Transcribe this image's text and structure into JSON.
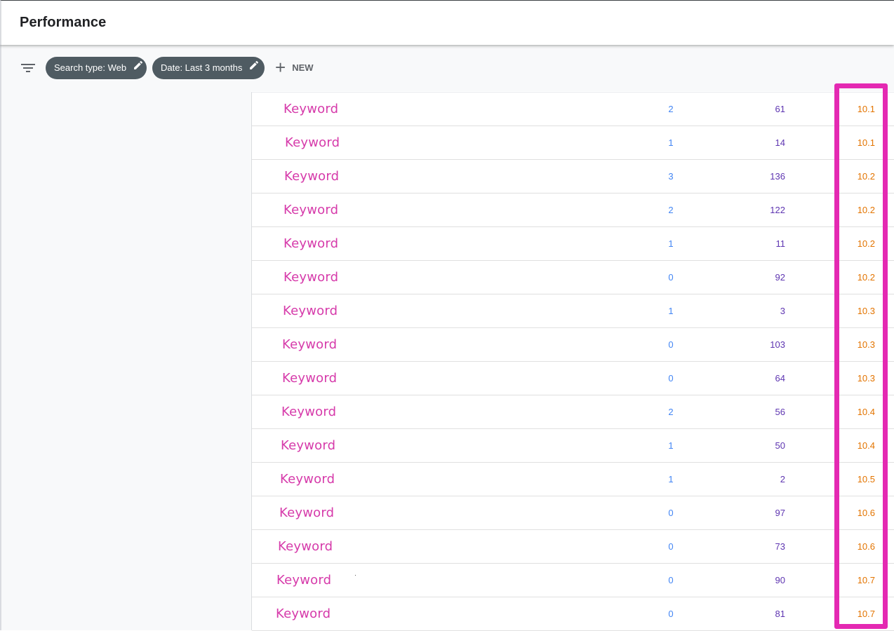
{
  "header": {
    "title": "Performance"
  },
  "filters": {
    "search_type_chip": "Search type: Web",
    "date_chip": "Date: Last 3 months",
    "new_label": "NEW"
  },
  "colors": {
    "keyword": "#d63aaa",
    "clicks": "#4285f4",
    "impressions": "#5e35b1",
    "position": "#e37400",
    "highlight_box": "#e429b2",
    "chip_bg": "#4f5b62"
  },
  "icons": {
    "filter": "filter-icon",
    "chip_edit": "pencil-icon",
    "new": "plus-icon"
  },
  "rows": [
    {
      "keyword": "Keyword",
      "clicks": "2",
      "impressions": "61",
      "position": "10.1"
    },
    {
      "keyword": "Keyword",
      "clicks": "1",
      "impressions": "14",
      "position": "10.1"
    },
    {
      "keyword": "Keyword",
      "clicks": "3",
      "impressions": "136",
      "position": "10.2"
    },
    {
      "keyword": "Keyword",
      "clicks": "2",
      "impressions": "122",
      "position": "10.2"
    },
    {
      "keyword": "Keyword",
      "clicks": "1",
      "impressions": "11",
      "position": "10.2"
    },
    {
      "keyword": "Keyword",
      "clicks": "0",
      "impressions": "92",
      "position": "10.2"
    },
    {
      "keyword": "Keyword",
      "clicks": "1",
      "impressions": "3",
      "position": "10.3"
    },
    {
      "keyword": "Keyword",
      "clicks": "0",
      "impressions": "103",
      "position": "10.3"
    },
    {
      "keyword": "Keyword",
      "clicks": "0",
      "impressions": "64",
      "position": "10.3"
    },
    {
      "keyword": "Keyword",
      "clicks": "2",
      "impressions": "56",
      "position": "10.4"
    },
    {
      "keyword": "Keyword",
      "clicks": "1",
      "impressions": "50",
      "position": "10.4"
    },
    {
      "keyword": "Keyword",
      "clicks": "1",
      "impressions": "2",
      "position": "10.5"
    },
    {
      "keyword": "Keyword",
      "clicks": "0",
      "impressions": "97",
      "position": "10.6"
    },
    {
      "keyword": "Keyword",
      "clicks": "0",
      "impressions": "73",
      "position": "10.6"
    },
    {
      "keyword": "Keyword",
      "clicks": "0",
      "impressions": "90",
      "position": "10.7"
    },
    {
      "keyword": "Keyword",
      "clicks": "0",
      "impressions": "81",
      "position": "10.7"
    }
  ]
}
